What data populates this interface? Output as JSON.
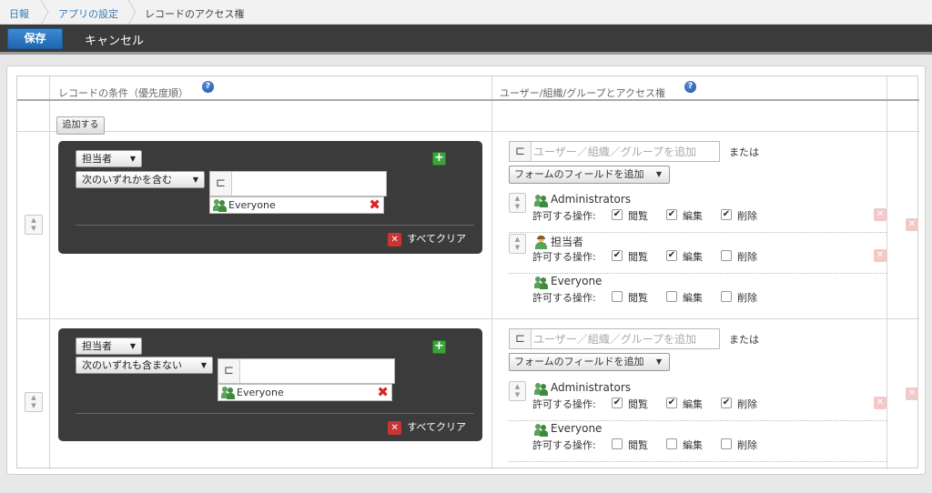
{
  "breadcrumb": {
    "items": [
      "日報",
      "アプリの設定",
      "レコードのアクセス権"
    ]
  },
  "toolbar": {
    "save_label": "保存",
    "cancel_label": "キャンセル"
  },
  "table": {
    "col_conditions": "レコードの条件（優先度順）",
    "col_users": "ユーザー/組織/グループとアクセス権",
    "help_glyph": "?",
    "add_label": "追加する"
  },
  "rules": [
    {
      "field": "担当者",
      "operator": "次のいずれかを含む",
      "value": "Everyone",
      "clear_label": "すべてクリア",
      "user_placeholder": "ユーザー／組織／グループを追加",
      "or_label": "または",
      "form_field_label": "フォームのフィールドを追加",
      "perm_label": "許可する操作:",
      "entities": [
        {
          "name": "Administrators",
          "icon": "group-icon",
          "view": true,
          "edit": true,
          "delete": true
        },
        {
          "name": "担当者",
          "icon": "user-icon",
          "view": true,
          "edit": true,
          "delete": false
        },
        {
          "name": "Everyone",
          "icon": "group-icon",
          "view": false,
          "edit": false,
          "delete": false
        }
      ]
    },
    {
      "field": "担当者",
      "operator": "次のいずれも含まない",
      "value": "Everyone",
      "clear_label": "すべてクリア",
      "user_placeholder": "ユーザー／組織／グループを追加",
      "or_label": "または",
      "form_field_label": "フォームのフィールドを追加",
      "perm_label": "許可する操作:",
      "entities": [
        {
          "name": "Administrators",
          "icon": "group-icon",
          "view": true,
          "edit": true,
          "delete": true
        },
        {
          "name": "Everyone",
          "icon": "group-icon",
          "view": false,
          "edit": false,
          "delete": false
        }
      ]
    }
  ],
  "permission_labels": {
    "view": "閲覧",
    "edit": "編集",
    "delete": "削除"
  },
  "colors": {
    "accent": "#1e66b0",
    "toolbar": "#3b3b3b",
    "condition_box": "#3b3b3b",
    "add_green": "#3aa33a",
    "remove_red": "#cc3333"
  }
}
